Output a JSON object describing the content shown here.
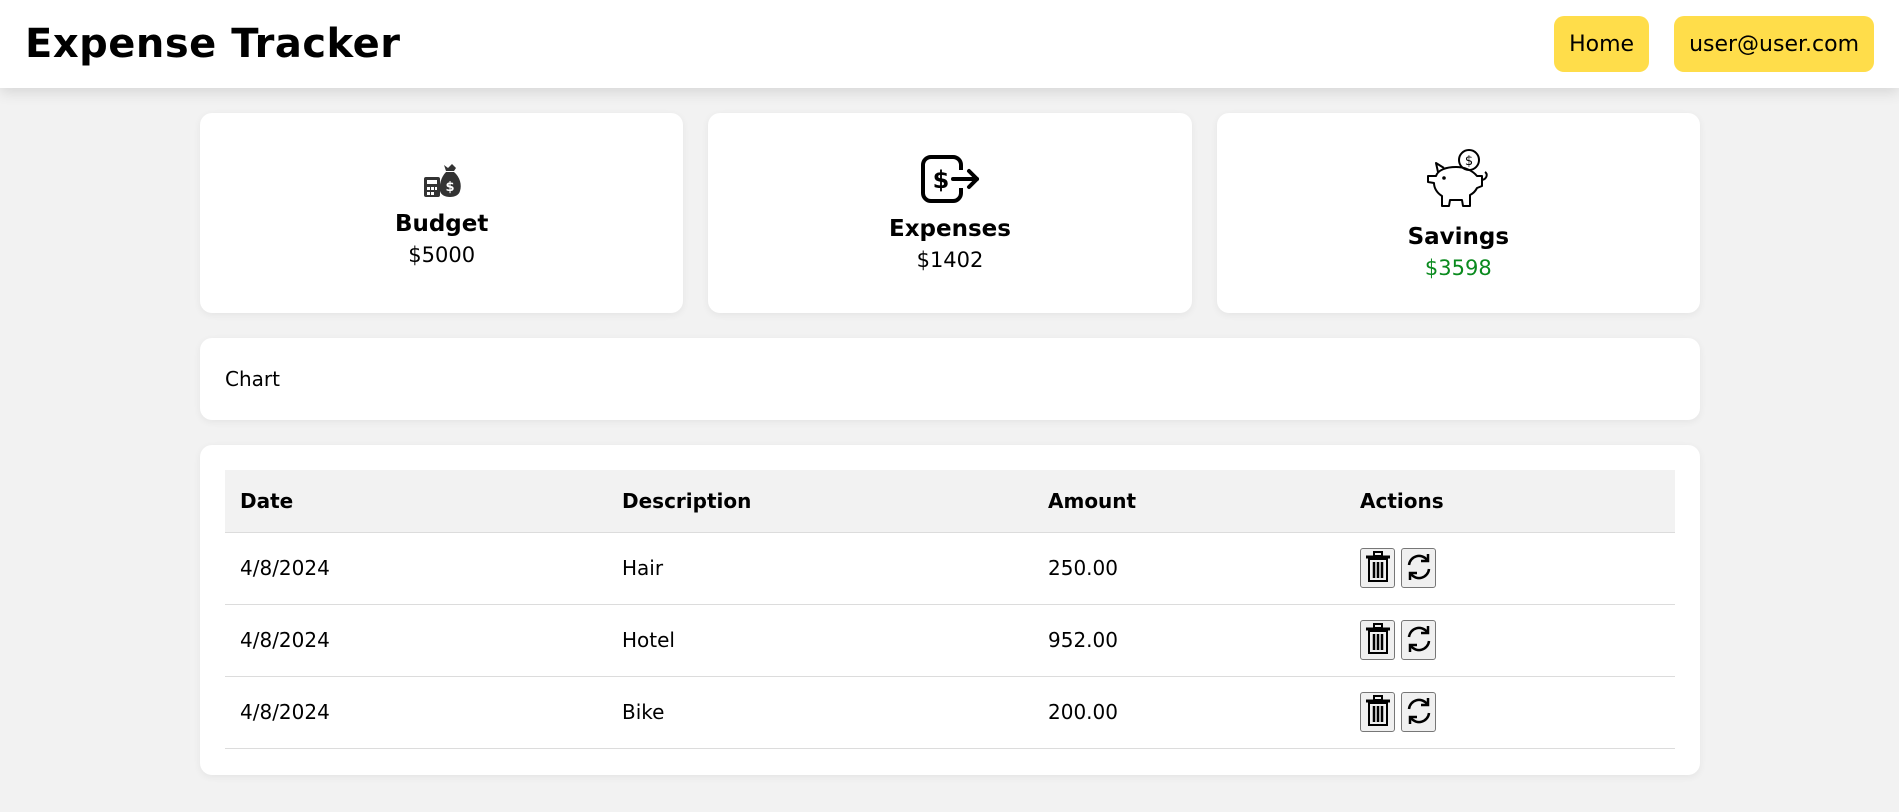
{
  "header": {
    "title": "Expense Tracker",
    "nav": {
      "home_label": "Home",
      "user_label": "user@user.com"
    }
  },
  "colors": {
    "accent": "#ffdd4a",
    "savings": "#0a8a1e",
    "background": "#f2f2f2"
  },
  "summary": {
    "budget": {
      "label": "Budget",
      "value": "$5000",
      "icon": "money-bag-calculator-icon"
    },
    "expenses": {
      "label": "Expenses",
      "value": "$1402",
      "icon": "dollar-exit-icon"
    },
    "savings": {
      "label": "Savings",
      "value": "$3598",
      "icon": "piggy-bank-icon"
    }
  },
  "chart": {
    "label": "Chart"
  },
  "table": {
    "headers": {
      "date": "Date",
      "description": "Description",
      "amount": "Amount",
      "actions": "Actions"
    },
    "rows": [
      {
        "date": "4/8/2024",
        "description": "Hair",
        "amount": "250.00"
      },
      {
        "date": "4/8/2024",
        "description": "Hotel",
        "amount": "952.00"
      },
      {
        "date": "4/8/2024",
        "description": "Bike",
        "amount": "200.00"
      }
    ]
  }
}
